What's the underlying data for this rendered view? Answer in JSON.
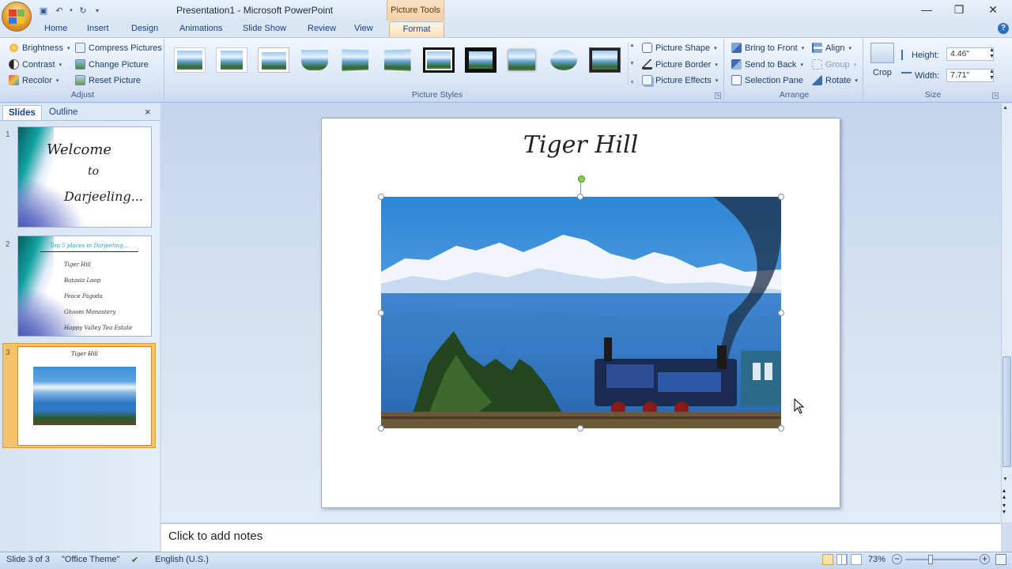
{
  "window": {
    "doc_title": "Presentation1 - Microsoft PowerPoint",
    "context_tab": "Picture Tools"
  },
  "tabs": [
    "Home",
    "Insert",
    "Design",
    "Animations",
    "Slide Show",
    "Review",
    "View",
    "Format"
  ],
  "ribbon": {
    "adjust": {
      "label": "Adjust",
      "brightness": "Brightness",
      "contrast": "Contrast",
      "recolor": "Recolor",
      "compress": "Compress Pictures",
      "change": "Change Picture",
      "reset": "Reset Picture"
    },
    "styles": {
      "label": "Picture Styles",
      "shape": "Picture Shape",
      "border": "Picture Border",
      "effects": "Picture Effects"
    },
    "arrange": {
      "label": "Arrange",
      "front": "Bring to Front",
      "back": "Send to Back",
      "pane": "Selection Pane",
      "align": "Align",
      "group": "Group",
      "rotate": "Rotate"
    },
    "size": {
      "label": "Size",
      "crop": "Crop",
      "height_label": "Height:",
      "height_value": "4.46\"",
      "width_label": "Width:",
      "width_value": "7.71\""
    }
  },
  "pane": {
    "tab_slides": "Slides",
    "tab_outline": "Outline",
    "close": "×",
    "slide1": {
      "num": "1",
      "line1": "Welcome",
      "line2": "to",
      "line3": "Darjeeling..."
    },
    "slide2": {
      "num": "2",
      "title": "Top 5 places in Darjeeling...",
      "bullets": [
        "Tiger Hill",
        "Batasia Loop",
        "Peace Pagoda",
        "Ghoom Monastery",
        "Happy Valley Tea Estate"
      ]
    },
    "slide3": {
      "num": "3",
      "title": "Tiger Hill"
    }
  },
  "slide": {
    "title": "Tiger Hill"
  },
  "notes": {
    "placeholder": "Click to add notes"
  },
  "status": {
    "slide": "Slide 3 of 3",
    "theme": "\"Office Theme\"",
    "language": "English (U.S.)",
    "zoom": "73%"
  }
}
